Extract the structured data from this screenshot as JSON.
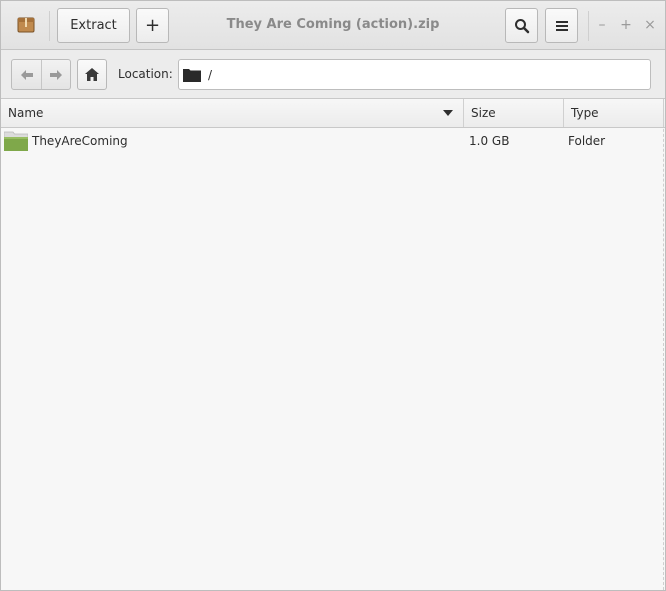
{
  "window": {
    "title": "They Are Coming (action).zip"
  },
  "toolbar": {
    "app_icon": "archive-icon",
    "extract_label": "Extract",
    "add_label": "+",
    "search_icon": "search-icon",
    "menu_icon": "hamburger-menu-icon",
    "minimize_label": "–",
    "maximize_label": "+",
    "close_label": "×"
  },
  "location": {
    "back_icon": "arrow-left-icon",
    "forward_icon": "arrow-right-icon",
    "home_icon": "home-icon",
    "label": "Location:",
    "path": "/"
  },
  "columns": [
    {
      "label": "Name",
      "sorted": "descending"
    },
    {
      "label": "Size"
    },
    {
      "label": "Type"
    }
  ],
  "files": [
    {
      "name": "TheyAreComing",
      "size": "1.0 GB",
      "type": "Folder",
      "icon": "folder-green-icon"
    }
  ],
  "colors": {
    "folder": "#7fa84a",
    "title_text": "#8a8a8a"
  }
}
